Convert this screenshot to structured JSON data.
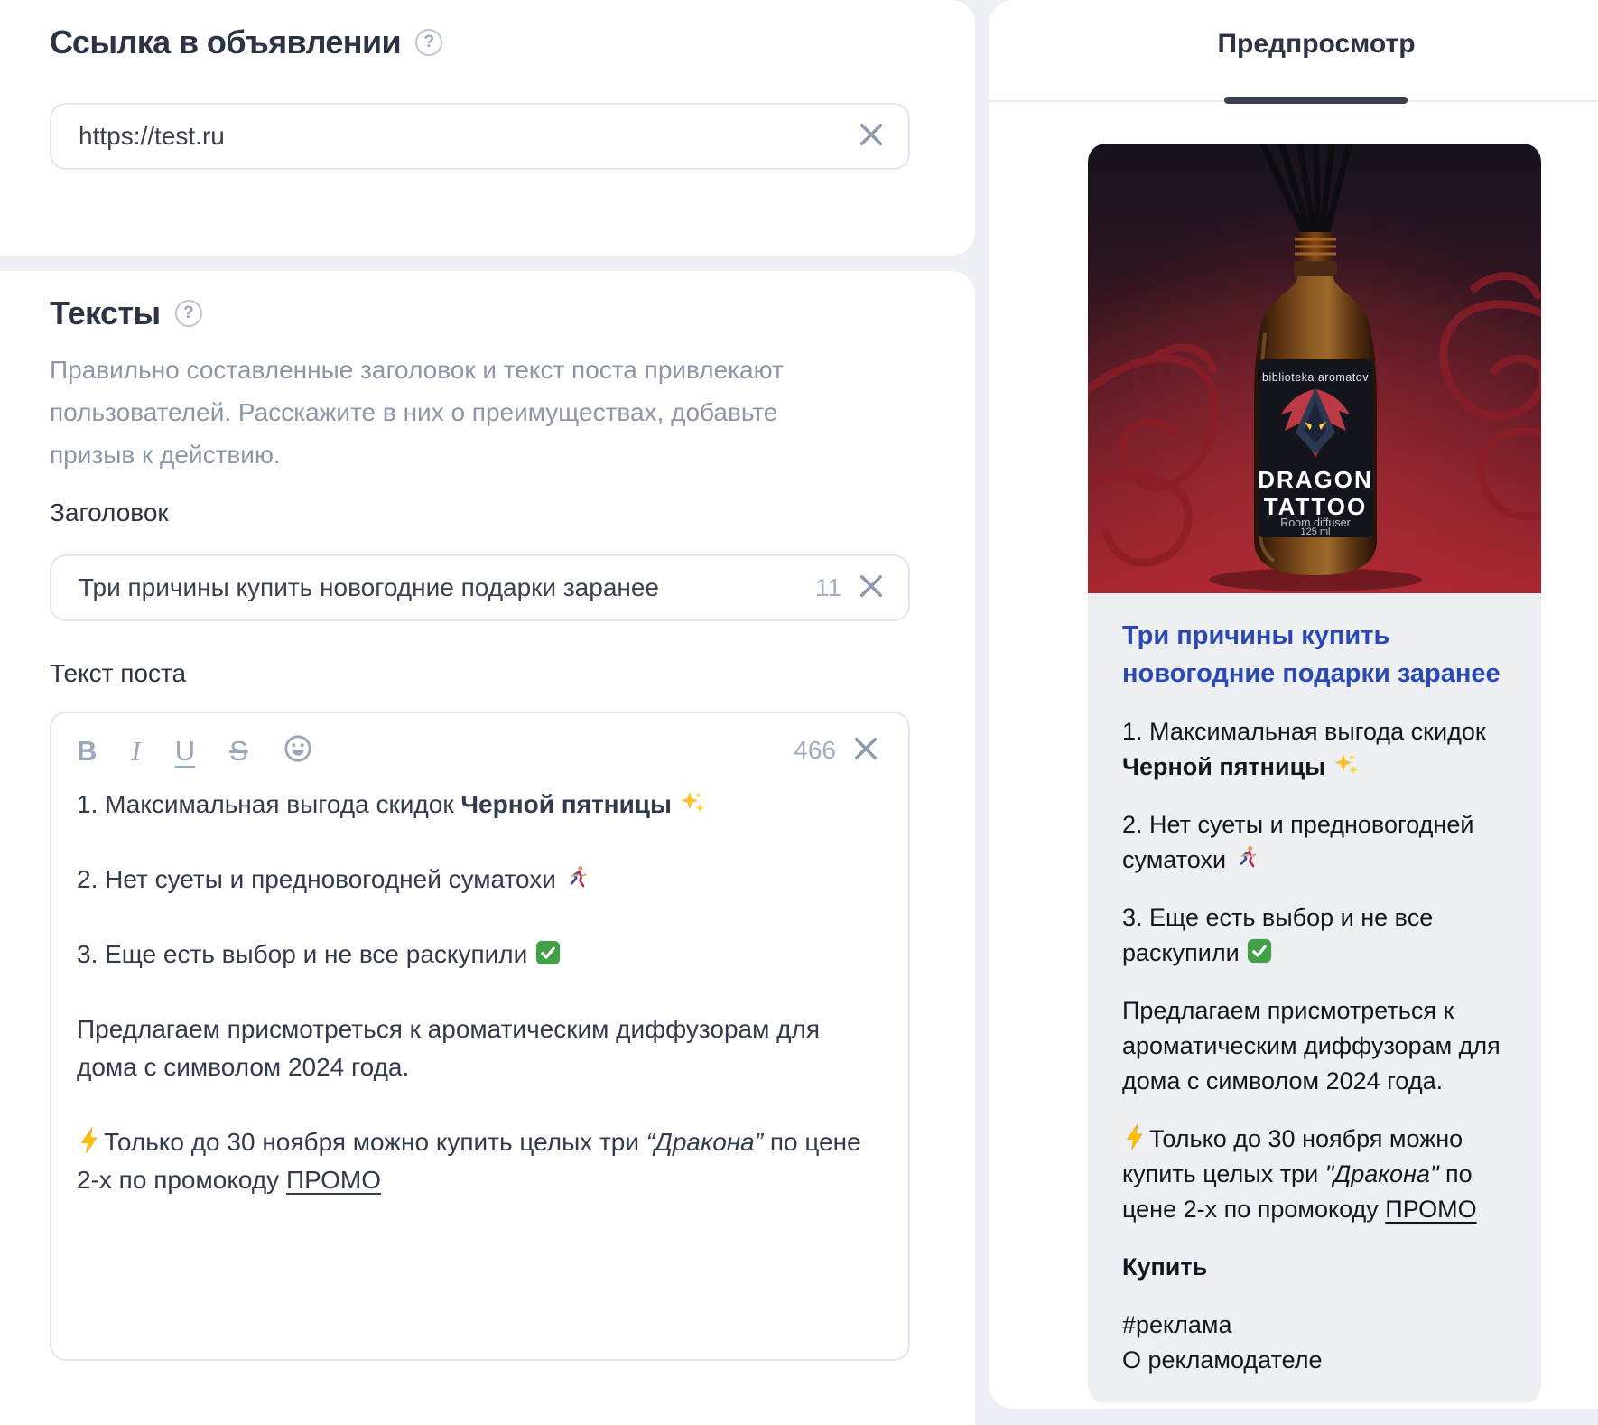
{
  "icons": {
    "help": "?",
    "bold": "B",
    "italic": "I",
    "underline": "U",
    "strike": "S",
    "sparkles": "✨",
    "runner": "🏃",
    "check": "✅",
    "lightning": "⚡"
  },
  "link_section": {
    "title": "Ссылка в объявлении",
    "url_value": "https://test.ru"
  },
  "texts_section": {
    "title": "Тексты",
    "description": "Правильно составленные заголовок и текст поста привлекают пользователей. Расскажите в них о преимуществах, добавьте призыв к действию.",
    "header_label": "Заголовок",
    "header_value": "Три причины купить новогодние подарки заранее",
    "header_counter": "11",
    "post_label": "Текст поста",
    "post_counter": "466"
  },
  "post_text": {
    "item1_pre": "1.  Максимальная выгода скидок ",
    "item1_bold": "Черной пятницы",
    "item2": "2. Нет суеты и предновогодней суматохи ",
    "item3": "3. Еще есть выбор и не все раскупили ",
    "para": "Предлагаем присмотреться к ароматическим диффузорам для дома с символом 2024 года.",
    "promo_pre": "Только до 30 ноября можно купить целых три ",
    "promo_italic": "“Дракона”",
    "promo_mid": " по цене 2-х по промокоду ",
    "promo_code": "ПРОМО"
  },
  "preview": {
    "tab": "Предпросмотр",
    "product": {
      "brand": "biblioteka aromatov",
      "name_line1": "DRAGON",
      "name_line2": "TATTOO",
      "type": "Room diffuser",
      "volume": "125 ml"
    },
    "title": "Три причины купить новогодние подарки заранее",
    "item1_pre": "1. Максимальная выгода скидок ",
    "item1_bold": "Черной пятницы",
    "item2": "2. Нет суеты и предновогодней суматохи ",
    "item3": "3. Еще есть выбор и не все раскупили ",
    "para": "Предлагаем присмотреться к ароматическим диффузорам для дома с символом 2024 года.",
    "promo_pre": "Только до 30 ноября можно купить целых три ",
    "promo_italic": "\"Дракона\"",
    "promo_mid": " по цене 2-х по промокоду ",
    "promo_code": "ПРОМО",
    "cta": "Купить",
    "hashtag": "#реклама",
    "about": "О рекламодателе"
  }
}
